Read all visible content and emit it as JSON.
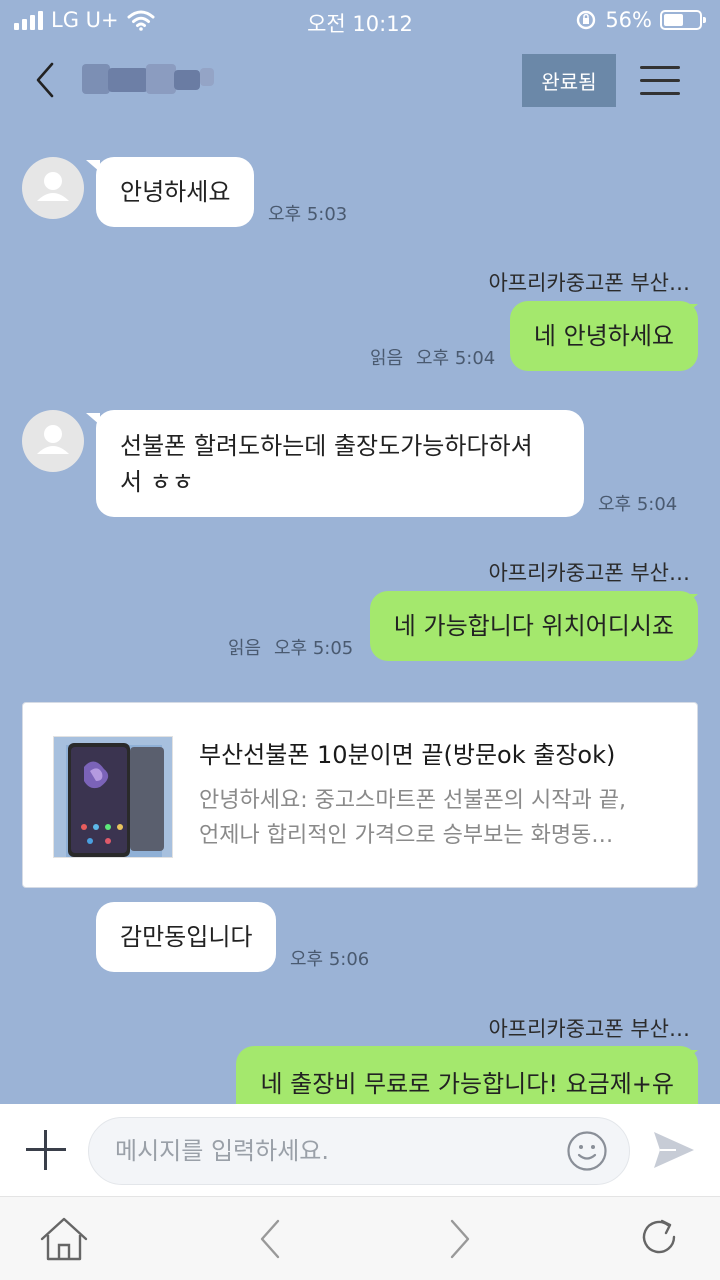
{
  "status_bar": {
    "carrier": "LG U+",
    "time": "오전 10:12",
    "battery": "56%",
    "battery_level": 0.56
  },
  "header": {
    "done_label": "완료됨"
  },
  "messages": [
    {
      "text": "안녕하세요",
      "time": "오후 5:03"
    },
    {
      "sender": "아프리카중고폰 부산…",
      "text": "네 안녕하세요",
      "read": "읽음",
      "time": "오후 5:04"
    },
    {
      "text_line1": "선불폰 할려도하는데 출장도가능하다하셔",
      "text_line2": "서 ㅎㅎ",
      "time": "오후 5:04"
    },
    {
      "sender": "아프리카중고폰 부산…",
      "text": "네 가능합니다 위치어디시죠",
      "read": "읽음",
      "time": "오후 5:05"
    },
    {
      "text": "감만동입니다",
      "time": "오후 5:06"
    },
    {
      "sender": "아프리카중고폰 부산…",
      "text": "네 출장비 무료로 가능합니다! 요금제+유"
    }
  ],
  "link_card": {
    "title": "부산선불폰 10분이면 끝(방문ok 출장ok)",
    "desc_line1": "안녕하세요: 중고스마트폰 선불폰의 시작과 끝,",
    "desc_line2": "언제나 합리적인 가격으로 승부보는 화명동…"
  },
  "input": {
    "placeholder": "메시지를 입력하세요."
  },
  "colors": {
    "background": "#9bb3d6",
    "outgoing_bubble": "#a4e86d",
    "incoming_bubble": "#ffffff",
    "done_button": "#6b88a8"
  },
  "icons": [
    "signal-icon",
    "wifi-icon",
    "orientation-lock-icon",
    "battery-icon",
    "back-arrow-icon",
    "menu-icon",
    "avatar-icon",
    "plus-icon",
    "emoji-icon",
    "send-icon",
    "home-icon",
    "nav-back-icon",
    "nav-forward-icon",
    "refresh-icon"
  ]
}
